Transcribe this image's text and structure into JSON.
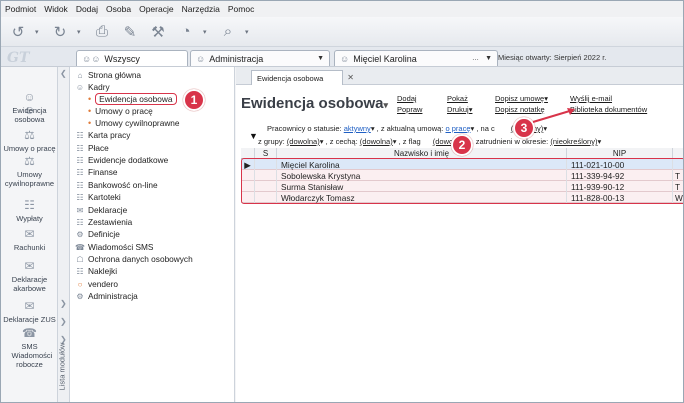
{
  "menu": [
    "Podmiot",
    "Widok",
    "Dodaj",
    "Osoba",
    "Operacje",
    "Narzędzia",
    "Pomoc"
  ],
  "toolbar_icons": [
    "back-icon",
    "forward-icon",
    "print-icon",
    "edit-icon",
    "tools-icon",
    "pie-icon",
    "search-icon"
  ],
  "context": {
    "tab_all": "Wszyscy",
    "tab_admin": "Administracja",
    "tab_person": "Mięciel Karolina",
    "month_open": "Miesiąc otwarty: Sierpień 2022 r."
  },
  "left_strip": [
    {
      "label": "Ewidencja osobowa",
      "icon": "people-icon"
    },
    {
      "label": "Umowy o pracę",
      "icon": "contract-icon"
    },
    {
      "label": "Umowy cywilnoprawne",
      "icon": "civil-contract-icon"
    },
    {
      "label": "Wypłaty",
      "icon": "payout-icon"
    },
    {
      "label": "Rachunki",
      "icon": "bill-icon"
    },
    {
      "label": "Deklaracje akarbowe",
      "icon": "declaration-icon"
    },
    {
      "label": "Deklaracje ZUS",
      "icon": "zus-icon"
    },
    {
      "label": "SMS Wiadomości robocze",
      "icon": "sms-icon"
    }
  ],
  "module_list_label": "Lista modułów",
  "tree": [
    {
      "label": "Strona główna",
      "level": 0,
      "icon": "home-icon"
    },
    {
      "label": "Kadry",
      "level": 0,
      "icon": "people-icon"
    },
    {
      "label": "Ewidencja osobowa",
      "level": 1,
      "icon": "bullet"
    },
    {
      "label": "Umowy o pracę",
      "level": 1,
      "icon": "bullet"
    },
    {
      "label": "Umowy cywilnoprawne",
      "level": 1,
      "icon": "bullet"
    },
    {
      "label": "Karta pracy",
      "level": 0,
      "icon": "card-icon"
    },
    {
      "label": "Płace",
      "level": 0,
      "icon": "wage-icon"
    },
    {
      "label": "Ewidencje dodatkowe",
      "level": 0,
      "icon": "extra-icon"
    },
    {
      "label": "Finanse",
      "level": 0,
      "icon": "finance-icon"
    },
    {
      "label": "Bankowość on-line",
      "level": 0,
      "icon": "bank-icon"
    },
    {
      "label": "Kartoteki",
      "level": 0,
      "icon": "files-icon"
    },
    {
      "label": "Deklaracje",
      "level": 0,
      "icon": "declaration-icon"
    },
    {
      "label": "Zestawienia",
      "level": 0,
      "icon": "report-icon"
    },
    {
      "label": "Definicje",
      "level": 0,
      "icon": "definition-icon"
    },
    {
      "label": "Wiadomości SMS",
      "level": 0,
      "icon": "sms-icon"
    },
    {
      "label": "Ochrona danych osobowych",
      "level": 0,
      "icon": "shield-icon"
    },
    {
      "label": "Naklejki",
      "level": 0,
      "icon": "sticker-icon"
    },
    {
      "label": "vendero",
      "level": 0,
      "icon": "vendero-icon"
    },
    {
      "label": "Administracja",
      "level": 0,
      "icon": "admin-icon"
    }
  ],
  "doc_tab": "Ewidencja osobowa",
  "title": "Ewidencja osobowa",
  "actions": {
    "dodaj": "Dodaj",
    "popraw": "Popraw",
    "pokaz": "Pokaż",
    "drukuj": "Drukuj",
    "dopisz_umowe": "Dopisz umowę",
    "dopisz_notatke": "Dopisz notatkę",
    "wyslij_email": "Wyślij e-mail",
    "biblioteka": "Biblioteka dokumentów"
  },
  "filters": {
    "status_label": "Pracownicy o statusie:",
    "status_value": "aktywny",
    "umowa_label": ", z aktualną umową:",
    "umowa_value": "o pracę",
    "na_label": ", na c",
    "na_value": "(dowolny)",
    "grupy_label": "z grupy:",
    "grupy_value": "(dowolna)",
    "cecha_label": ", z cechą:",
    "cecha_value": "(dowolna)",
    "flaga_label": ", z flag",
    "flaga_value": "(dowolna)",
    "okres_label": ", zatrudnieni w okresie:",
    "okres_value": "(nieokreślony)"
  },
  "grid": {
    "columns": [
      "S",
      "Nazwisko i imię",
      "NIP"
    ],
    "rows": [
      {
        "name": "Mięciel Karolina",
        "nip": "111-021-10-00",
        "extra": ""
      },
      {
        "name": "Sobolewska Krystyna",
        "nip": "111-339-94-92",
        "extra": "T"
      },
      {
        "name": "Surma Stanisław",
        "nip": "111-939-90-12",
        "extra": "T"
      },
      {
        "name": "Włodarczyk Tomasz",
        "nip": "111-828-00-13",
        "extra": "W"
      }
    ]
  },
  "badges": [
    "1",
    "2",
    "3"
  ],
  "colors": {
    "accent_red": "#d8344a",
    "link_blue": "#1f5fc4",
    "selection": "#dce8f8"
  }
}
